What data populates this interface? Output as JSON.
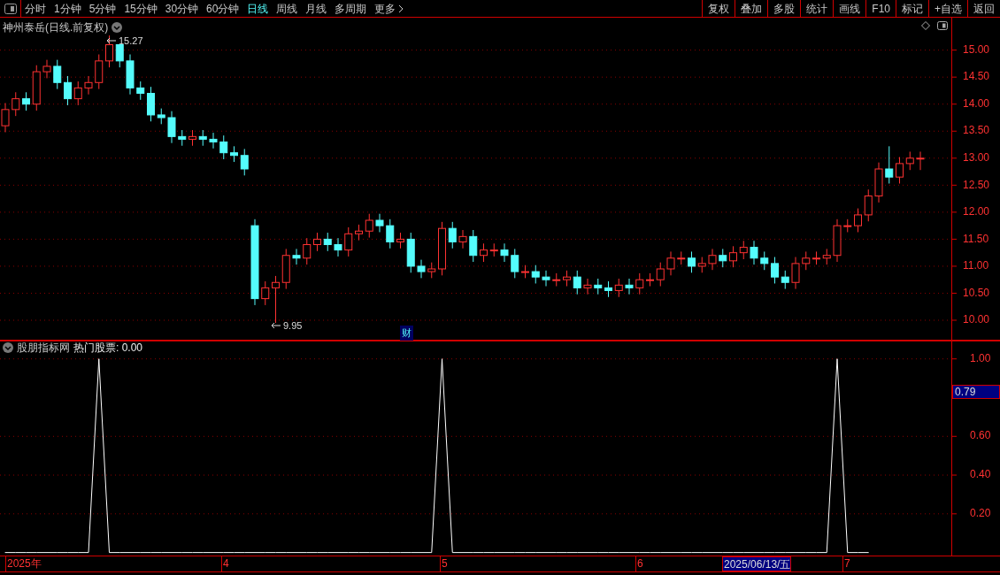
{
  "toolbar": {
    "periods": [
      {
        "label": "分时",
        "selected": false
      },
      {
        "label": "1分钟",
        "selected": false
      },
      {
        "label": "5分钟",
        "selected": false
      },
      {
        "label": "15分钟",
        "selected": false
      },
      {
        "label": "30分钟",
        "selected": false
      },
      {
        "label": "60分钟",
        "selected": false
      },
      {
        "label": "日线",
        "selected": true
      },
      {
        "label": "周线",
        "selected": false
      },
      {
        "label": "月线",
        "selected": false
      },
      {
        "label": "多周期",
        "selected": false
      },
      {
        "label": "更多",
        "selected": false
      }
    ],
    "actions": [
      "复权",
      "叠加",
      "多股",
      "统计",
      "画线",
      "F10",
      "标记",
      "+自选",
      "返回"
    ]
  },
  "main_chart": {
    "title": "神州泰岳(日线.前复权)",
    "high_label": "15.27",
    "low_label": "9.95",
    "event_badge": "财",
    "chart_data": {
      "type": "candlestick",
      "ylim": [
        9.64,
        15.6
      ],
      "grid": true,
      "yticks": [
        {
          "value": 15,
          "label": "15.00"
        },
        {
          "value": 14.5,
          "label": "14.50"
        },
        {
          "value": 14,
          "label": "14.00"
        },
        {
          "value": 13.5,
          "label": "13.50"
        },
        {
          "value": 13,
          "label": "13.00"
        },
        {
          "value": 12.5,
          "label": "12.50"
        },
        {
          "value": 12,
          "label": "12.00"
        },
        {
          "value": 11.5,
          "label": "11.50"
        },
        {
          "value": 11,
          "label": "11.00"
        },
        {
          "value": 10.5,
          "label": "10.50"
        },
        {
          "value": 10,
          "label": "10.00"
        }
      ],
      "ohlc": [
        [
          13.6,
          14.02,
          13.48,
          13.9
        ],
        [
          13.9,
          14.22,
          13.78,
          14.1
        ],
        [
          14.1,
          14.22,
          13.88,
          14.0
        ],
        [
          14.0,
          14.72,
          13.88,
          14.6
        ],
        [
          14.6,
          14.82,
          14.48,
          14.7
        ],
        [
          14.7,
          14.82,
          14.28,
          14.4
        ],
        [
          14.4,
          14.52,
          13.98,
          14.1
        ],
        [
          14.1,
          14.42,
          13.98,
          14.3
        ],
        [
          14.3,
          14.52,
          14.18,
          14.4
        ],
        [
          14.4,
          14.92,
          14.28,
          14.8
        ],
        [
          14.8,
          15.27,
          14.68,
          15.1
        ],
        [
          15.1,
          15.1,
          14.68,
          14.8
        ],
        [
          14.8,
          14.92,
          14.18,
          14.3
        ],
        [
          14.3,
          14.42,
          14.08,
          14.2
        ],
        [
          14.2,
          14.32,
          13.68,
          13.8
        ],
        [
          13.8,
          13.92,
          13.63,
          13.75
        ],
        [
          13.75,
          13.87,
          13.28,
          13.4
        ],
        [
          13.4,
          13.52,
          13.23,
          13.35
        ],
        [
          13.35,
          13.52,
          13.23,
          13.4
        ],
        [
          13.4,
          13.52,
          13.23,
          13.35
        ],
        [
          13.35,
          13.47,
          13.18,
          13.3
        ],
        [
          13.3,
          13.42,
          12.98,
          13.1
        ],
        [
          13.1,
          13.22,
          12.93,
          13.05
        ],
        [
          13.05,
          13.17,
          12.68,
          12.8
        ],
        [
          11.75,
          11.87,
          10.28,
          10.4
        ],
        [
          10.4,
          10.72,
          10.28,
          10.6
        ],
        [
          10.6,
          10.82,
          9.95,
          10.7
        ],
        [
          10.7,
          11.32,
          10.58,
          11.2
        ],
        [
          11.2,
          11.32,
          11.03,
          11.15
        ],
        [
          11.15,
          11.52,
          11.03,
          11.4
        ],
        [
          11.4,
          11.62,
          11.28,
          11.5
        ],
        [
          11.5,
          11.62,
          11.28,
          11.4
        ],
        [
          11.4,
          11.52,
          11.18,
          11.3
        ],
        [
          11.3,
          11.72,
          11.18,
          11.6
        ],
        [
          11.6,
          11.77,
          11.48,
          11.65
        ],
        [
          11.65,
          11.97,
          11.53,
          11.85
        ],
        [
          11.85,
          11.97,
          11.63,
          11.75
        ],
        [
          11.75,
          11.87,
          11.33,
          11.45
        ],
        [
          11.45,
          11.62,
          11.33,
          11.5
        ],
        [
          11.5,
          11.62,
          10.88,
          11.0
        ],
        [
          11.0,
          11.12,
          10.78,
          10.9
        ],
        [
          10.9,
          11.07,
          10.78,
          10.95
        ],
        [
          10.95,
          11.82,
          10.83,
          11.7
        ],
        [
          11.7,
          11.82,
          11.33,
          11.45
        ],
        [
          11.45,
          11.67,
          11.33,
          11.55
        ],
        [
          11.55,
          11.67,
          11.08,
          11.2
        ],
        [
          11.2,
          11.42,
          11.08,
          11.3
        ],
        [
          11.3,
          11.42,
          11.18,
          11.3
        ],
        [
          11.3,
          11.42,
          11.08,
          11.2
        ],
        [
          11.2,
          11.32,
          10.78,
          10.9
        ],
        [
          10.9,
          11.02,
          10.78,
          10.9
        ],
        [
          10.9,
          11.02,
          10.68,
          10.8
        ],
        [
          10.8,
          10.92,
          10.63,
          10.75
        ],
        [
          10.75,
          10.87,
          10.63,
          10.75
        ],
        [
          10.75,
          10.92,
          10.63,
          10.8
        ],
        [
          10.8,
          10.92,
          10.48,
          10.6
        ],
        [
          10.6,
          10.77,
          10.48,
          10.65
        ],
        [
          10.65,
          10.77,
          10.48,
          10.6
        ],
        [
          10.6,
          10.72,
          10.43,
          10.55
        ],
        [
          10.55,
          10.77,
          10.43,
          10.65
        ],
        [
          10.65,
          10.77,
          10.48,
          10.6
        ],
        [
          10.6,
          10.87,
          10.48,
          10.75
        ],
        [
          10.75,
          10.87,
          10.63,
          10.75
        ],
        [
          10.75,
          11.07,
          10.63,
          10.95
        ],
        [
          10.95,
          11.27,
          10.83,
          11.15
        ],
        [
          11.15,
          11.27,
          11.03,
          11.15
        ],
        [
          11.15,
          11.27,
          10.88,
          11.0
        ],
        [
          11.0,
          11.17,
          10.88,
          11.05
        ],
        [
          11.05,
          11.32,
          10.93,
          11.2
        ],
        [
          11.2,
          11.32,
          10.98,
          11.1
        ],
        [
          11.1,
          11.37,
          10.98,
          11.25
        ],
        [
          11.25,
          11.47,
          11.13,
          11.35
        ],
        [
          11.35,
          11.47,
          11.03,
          11.15
        ],
        [
          11.15,
          11.27,
          10.93,
          11.05
        ],
        [
          11.05,
          11.17,
          10.68,
          10.8
        ],
        [
          10.8,
          10.92,
          10.58,
          10.7
        ],
        [
          10.7,
          11.17,
          10.58,
          11.05
        ],
        [
          11.05,
          11.27,
          10.93,
          11.15
        ],
        [
          11.15,
          11.27,
          11.03,
          11.15
        ],
        [
          11.15,
          11.32,
          11.03,
          11.2
        ],
        [
          11.2,
          11.87,
          11.08,
          11.75
        ],
        [
          11.75,
          11.87,
          11.63,
          11.75
        ],
        [
          11.75,
          12.07,
          11.63,
          11.95
        ],
        [
          11.95,
          12.42,
          11.83,
          12.3
        ],
        [
          12.3,
          12.92,
          12.18,
          12.8
        ],
        [
          12.8,
          13.22,
          12.53,
          12.65
        ],
        [
          12.65,
          13.02,
          12.53,
          12.9
        ],
        [
          12.9,
          13.12,
          12.78,
          13.0
        ],
        [
          13.0,
          13.12,
          12.78,
          13.0
        ]
      ]
    }
  },
  "indicator": {
    "name": "股朋指标网",
    "series_value": ": 0.00",
    "cursor_value": "0.79",
    "chart_data": {
      "type": "line",
      "ylim": [
        -0.02,
        1.09
      ],
      "grid": true,
      "yticks": [
        {
          "value": 0.2,
          "label": "0.20"
        },
        {
          "value": 0.4,
          "label": "0.40"
        },
        {
          "value": 0.6,
          "label": "0.60"
        },
        {
          "value": 1,
          "label": "1.00"
        }
      ],
      "series": [
        {
          "name": "热门股票",
          "color": "#ffffff",
          "values": [
            0,
            0,
            0,
            0,
            0,
            0,
            0,
            0,
            0,
            1,
            0,
            0,
            0,
            0,
            0,
            0,
            0,
            0,
            0,
            0,
            0,
            0,
            0,
            0,
            0,
            0,
            0,
            0,
            0,
            0,
            0,
            0,
            0,
            0,
            0,
            0,
            0,
            0,
            0,
            0,
            0,
            0,
            1,
            0,
            0,
            0,
            0,
            0,
            0,
            0,
            0,
            0,
            0,
            0,
            0,
            0,
            0,
            0,
            0,
            0,
            0,
            0,
            0,
            0,
            0,
            0,
            0,
            0,
            0,
            0,
            0,
            0,
            0,
            0,
            0,
            0,
            0,
            0,
            0,
            0,
            1,
            0,
            0,
            0
          ]
        }
      ]
    }
  },
  "time_axis": {
    "labels": [
      {
        "label": "2025年",
        "selected": false
      },
      {
        "label": "4",
        "selected": false
      },
      {
        "label": "5",
        "selected": false
      },
      {
        "label": "6",
        "selected": false
      },
      {
        "label": "2025/06/13/五",
        "selected": true
      },
      {
        "label": "7",
        "selected": false
      }
    ]
  }
}
